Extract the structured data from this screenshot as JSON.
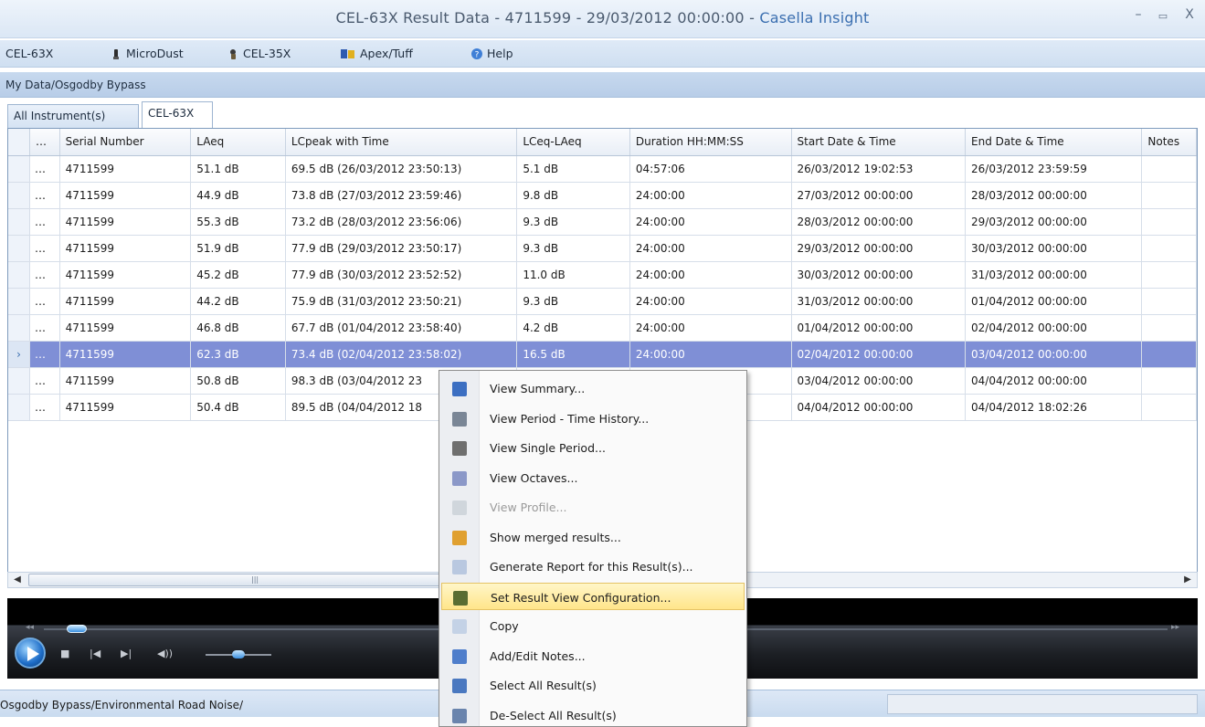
{
  "window": {
    "title_main": "CEL-63X Result Data - 4711599 - 29/03/2012 00:00:00 - ",
    "title_brand": "Casella Insight",
    "minimize": "–",
    "maximize": "▭",
    "close": "X"
  },
  "menu": {
    "items": [
      {
        "label": "CEL-63X",
        "icon": "none"
      },
      {
        "label": "MicroDust",
        "icon": "microdust-icon"
      },
      {
        "label": "CEL-35X",
        "icon": "cel35x-icon"
      },
      {
        "label": "Apex/Tuff",
        "icon": "apex-tuff-icon"
      },
      {
        "label": "Help",
        "icon": "help-icon"
      }
    ]
  },
  "breadcrumb": "My Data/Osgodby Bypass",
  "tabs": [
    {
      "label": "All Instrument(s)"
    },
    {
      "label": "CEL-63X"
    }
  ],
  "grid": {
    "columns": [
      "…",
      "Serial Number",
      "LAeq",
      "LCpeak with Time",
      "LCeq-LAeq",
      "Duration HH:MM:SS",
      "Start Date & Time",
      "End Date & Time",
      "Notes"
    ],
    "rows": [
      [
        "…",
        "4711599",
        "51.1 dB",
        "69.5 dB (26/03/2012 23:50:13)",
        "5.1 dB",
        "04:57:06",
        "26/03/2012 19:02:53",
        "26/03/2012 23:59:59",
        ""
      ],
      [
        "…",
        "4711599",
        "44.9 dB",
        "73.8 dB (27/03/2012 23:59:46)",
        "9.8 dB",
        "24:00:00",
        "27/03/2012 00:00:00",
        "28/03/2012 00:00:00",
        ""
      ],
      [
        "…",
        "4711599",
        "55.3 dB",
        "73.2 dB (28/03/2012 23:56:06)",
        "9.3 dB",
        "24:00:00",
        "28/03/2012 00:00:00",
        "29/03/2012 00:00:00",
        ""
      ],
      [
        "…",
        "4711599",
        "51.9 dB",
        "77.9 dB (29/03/2012 23:50:17)",
        "9.3 dB",
        "24:00:00",
        "29/03/2012 00:00:00",
        "30/03/2012 00:00:00",
        ""
      ],
      [
        "…",
        "4711599",
        "45.2 dB",
        "77.9 dB (30/03/2012 23:52:52)",
        "11.0 dB",
        "24:00:00",
        "30/03/2012 00:00:00",
        "31/03/2012 00:00:00",
        ""
      ],
      [
        "…",
        "4711599",
        "44.2 dB",
        "75.9 dB (31/03/2012 23:50:21)",
        "9.3 dB",
        "24:00:00",
        "31/03/2012 00:00:00",
        "01/04/2012 00:00:00",
        ""
      ],
      [
        "…",
        "4711599",
        "46.8 dB",
        "67.7 dB (01/04/2012 23:58:40)",
        "4.2 dB",
        "24:00:00",
        "01/04/2012 00:00:00",
        "02/04/2012 00:00:00",
        ""
      ],
      [
        "…",
        "4711599",
        "62.3 dB",
        "73.4 dB (02/04/2012 23:58:02)",
        "16.5 dB",
        "24:00:00",
        "02/04/2012 00:00:00",
        "03/04/2012 00:00:00",
        ""
      ],
      [
        "…",
        "4711599",
        "50.8 dB",
        "98.3 dB (03/04/2012 23",
        "",
        "",
        "03/04/2012 00:00:00",
        "04/04/2012 00:00:00",
        ""
      ],
      [
        "…",
        "4711599",
        "50.4 dB",
        "89.5 dB (04/04/2012 18",
        "",
        "",
        "04/04/2012 00:00:00",
        "04/04/2012 18:02:26",
        ""
      ]
    ],
    "selected_row": 7,
    "row_marker": "›"
  },
  "scrollbar": {
    "left": "◀",
    "right": "▶",
    "grip": "|||"
  },
  "player": {
    "prev": "|◀",
    "stop": "■",
    "next": "▶|",
    "volume": "◀))",
    "rewind": "◂◂",
    "forward": "▸▸",
    "seek_fraction": 0.02,
    "volume_fraction": 0.5
  },
  "status": "Osgodby Bypass/Environmental Road Noise/",
  "context_menu": {
    "items": [
      {
        "label": "View Summary...",
        "icon": "summary-icon",
        "color": "#3c6fc2",
        "disabled": false,
        "highlight": false
      },
      {
        "label": "View Period - Time History...",
        "icon": "time-history-icon",
        "color": "#7a8696",
        "disabled": false,
        "highlight": false
      },
      {
        "label": "View Single Period...",
        "icon": "single-period-icon",
        "color": "#6f6f6f",
        "disabled": false,
        "highlight": false
      },
      {
        "label": "View Octaves...",
        "icon": "octaves-icon",
        "color": "#8b98c8",
        "disabled": false,
        "highlight": false
      },
      {
        "label": "View Profile...",
        "icon": "profile-icon",
        "color": "#d0d6dc",
        "disabled": true,
        "highlight": false
      },
      {
        "label": "Show merged results...",
        "icon": "merged-results-icon",
        "color": "#e0a030",
        "disabled": false,
        "highlight": false
      },
      {
        "label": "Generate Report for this Result(s)...",
        "icon": "report-icon",
        "color": "#b9c8e0",
        "disabled": false,
        "highlight": false
      },
      {
        "label": "Set Result View Configuration...",
        "icon": "view-config-icon",
        "color": "#5a6d32",
        "disabled": false,
        "highlight": true
      },
      {
        "label": "Copy",
        "icon": "copy-icon",
        "color": "#c4d2e6",
        "disabled": false,
        "highlight": false
      },
      {
        "label": "Add/Edit Notes...",
        "icon": "notes-icon",
        "color": "#4f7ecb",
        "disabled": false,
        "highlight": false
      },
      {
        "label": "Select All Result(s)",
        "icon": "select-all-icon",
        "color": "#4a78c0",
        "disabled": false,
        "highlight": false
      },
      {
        "label": "De-Select All Result(s)",
        "icon": "deselect-all-icon",
        "color": "#6a84ad",
        "disabled": false,
        "highlight": false
      }
    ]
  }
}
